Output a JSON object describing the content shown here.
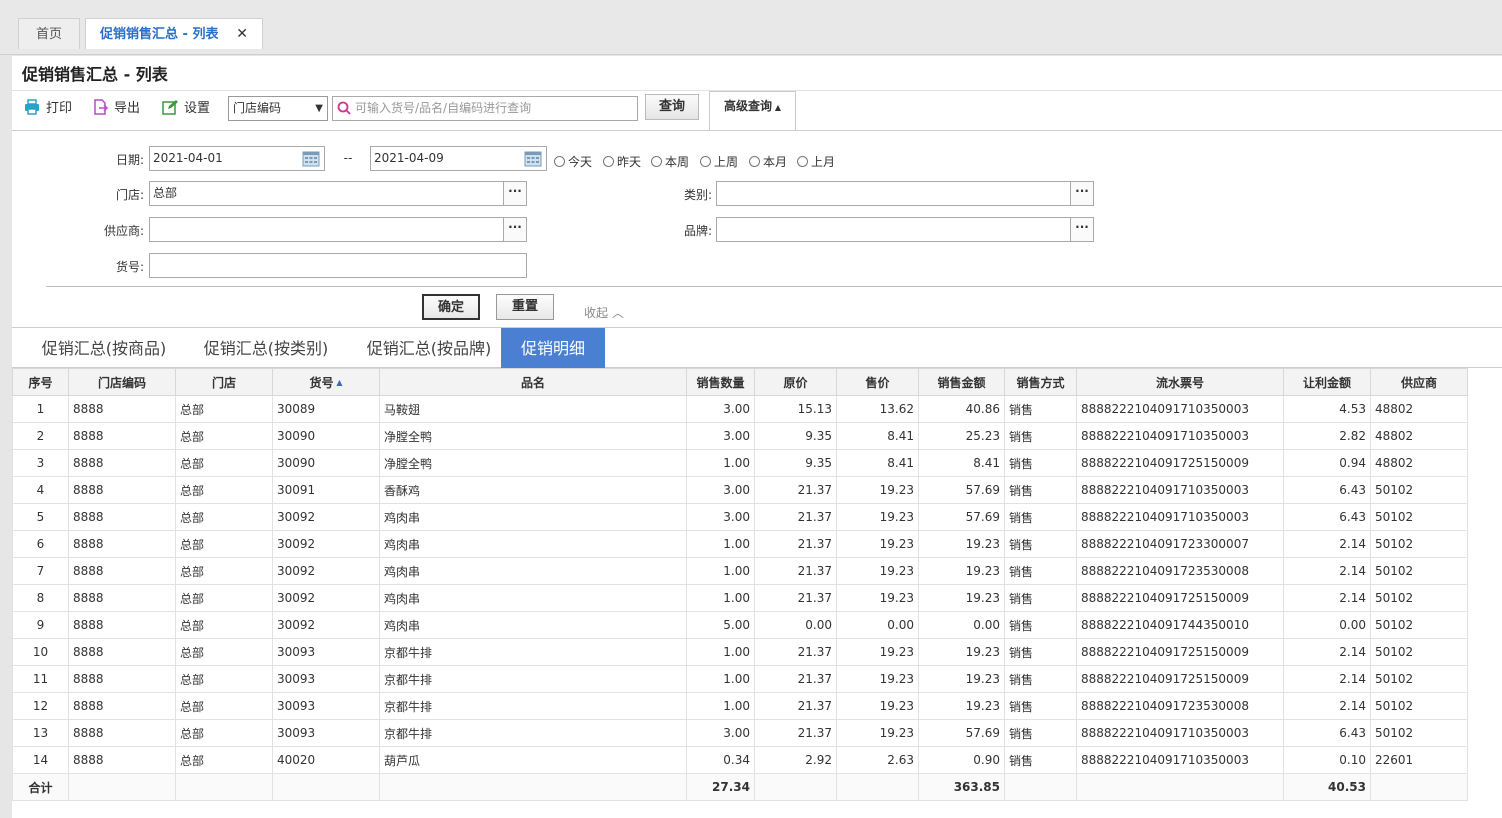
{
  "tabs": {
    "home": "首页",
    "active": "促销销售汇总 - 列表",
    "close": "✕"
  },
  "page_title": "促销销售汇总 - 列表",
  "toolbar": {
    "print": "打印",
    "export": "导出",
    "settings": "设置",
    "select_value": "门店编码",
    "search_placeholder": "可输入货号/品名/自编码进行查询",
    "query": "查询",
    "advanced": "高级查询"
  },
  "filter": {
    "date_label": "日期:",
    "date_from": "2021-04-01",
    "date_sep": "--",
    "date_to": "2021-04-09",
    "quick": [
      "今天",
      "昨天",
      "本周",
      "上周",
      "本月",
      "上月"
    ],
    "store_label": "门店:",
    "store_value": "总部",
    "category_label": "类别:",
    "category_value": "",
    "supplier_label": "供应商:",
    "supplier_value": "",
    "brand_label": "品牌:",
    "brand_value": "",
    "item_no_label": "货号:",
    "item_no_value": "",
    "ok": "确定",
    "reset": "重置",
    "collapse": "收起"
  },
  "subtabs": [
    "促销汇总(按商品)",
    "促销汇总(按类别)",
    "促销汇总(按品牌)",
    "促销明细"
  ],
  "table": {
    "headers": [
      "序号",
      "门店编码",
      "门店",
      "货号",
      "品名",
      "销售数量",
      "原价",
      "售价",
      "销售金额",
      "销售方式",
      "流水票号",
      "让利金额",
      "供应商"
    ],
    "rows": [
      [
        "1",
        "8888",
        "总部",
        "30089",
        "马鞍翅",
        "3.00",
        "15.13",
        "13.62",
        "40.86",
        "销售",
        "888822210409171035000 3",
        "4.53",
        "48802"
      ],
      [
        "2",
        "8888",
        "总部",
        "30090",
        "净膛全鸭",
        "3.00",
        "9.35",
        "8.41",
        "25.23",
        "销售",
        "8888222104091710350003",
        "2.82",
        "48802"
      ],
      [
        "3",
        "8888",
        "总部",
        "30090",
        "净膛全鸭",
        "1.00",
        "9.35",
        "8.41",
        "8.41",
        "销售",
        "8888222104091725150009",
        "0.94",
        "48802"
      ],
      [
        "4",
        "8888",
        "总部",
        "30091",
        "香酥鸡",
        "3.00",
        "21.37",
        "19.23",
        "57.69",
        "销售",
        "8888222104091710350003",
        "6.43",
        "50102"
      ],
      [
        "5",
        "8888",
        "总部",
        "30092",
        "鸡肉串",
        "3.00",
        "21.37",
        "19.23",
        "57.69",
        "销售",
        "8888222104091710350003",
        "6.43",
        "50102"
      ],
      [
        "6",
        "8888",
        "总部",
        "30092",
        "鸡肉串",
        "1.00",
        "21.37",
        "19.23",
        "19.23",
        "销售",
        "8888222104091723300007",
        "2.14",
        "50102"
      ],
      [
        "7",
        "8888",
        "总部",
        "30092",
        "鸡肉串",
        "1.00",
        "21.37",
        "19.23",
        "19.23",
        "销售",
        "8888222104091723530008",
        "2.14",
        "50102"
      ],
      [
        "8",
        "8888",
        "总部",
        "30092",
        "鸡肉串",
        "1.00",
        "21.37",
        "19.23",
        "19.23",
        "销售",
        "8888222104091725150009",
        "2.14",
        "50102"
      ],
      [
        "9",
        "8888",
        "总部",
        "30092",
        "鸡肉串",
        "5.00",
        "0.00",
        "0.00",
        "0.00",
        "销售",
        "8888222104091744350010",
        "0.00",
        "50102"
      ],
      [
        "10",
        "8888",
        "总部",
        "30093",
        "京都牛排",
        "1.00",
        "21.37",
        "19.23",
        "19.23",
        "销售",
        "8888222104091725150009",
        "2.14",
        "50102"
      ],
      [
        "11",
        "8888",
        "总部",
        "30093",
        "京都牛排",
        "1.00",
        "21.37",
        "19.23",
        "19.23",
        "销售",
        "8888222104091725150009",
        "2.14",
        "50102"
      ],
      [
        "12",
        "8888",
        "总部",
        "30093",
        "京都牛排",
        "1.00",
        "21.37",
        "19.23",
        "19.23",
        "销售",
        "8888222104091723530008",
        "2.14",
        "50102"
      ],
      [
        "13",
        "8888",
        "总部",
        "30093",
        "京都牛排",
        "3.00",
        "21.37",
        "19.23",
        "57.69",
        "销售",
        "8888222104091710350003",
        "6.43",
        "50102"
      ],
      [
        "14",
        "8888",
        "总部",
        "40020",
        "葫芦瓜",
        "0.34",
        "2.92",
        "2.63",
        "0.90",
        "销售",
        "8888222104091710350003",
        "0.10",
        "22601"
      ]
    ],
    "total": {
      "label": "合计",
      "qty": "27.34",
      "amount": "363.85",
      "discount": "40.53"
    }
  }
}
